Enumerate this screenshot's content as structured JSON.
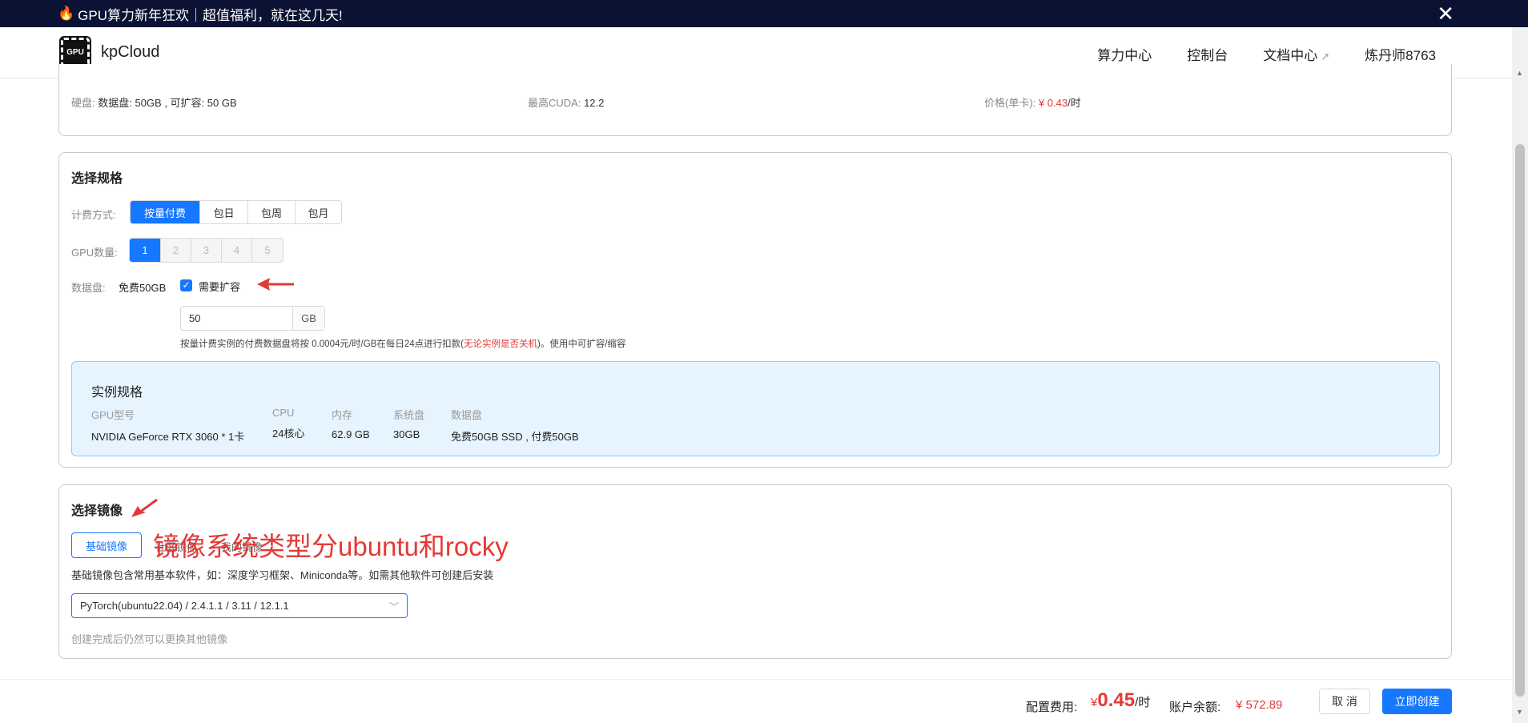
{
  "banner": {
    "fire_icon": "🔥",
    "text": "GPU算力新年狂欢｜超值福利，就在这几天!",
    "close": "✕"
  },
  "header": {
    "logo_text": "GPU",
    "brand": "kpCloud",
    "nav": [
      "算力中心",
      "控制台",
      "文档中心",
      "炼丹师8763"
    ],
    "doc_ext_icon": "↗"
  },
  "top_info": {
    "disk_label": "硬盘:",
    "disk_value": "数据盘: 50GB , 可扩容: 50 GB",
    "cuda_label": "最高CUDA:",
    "cuda_value": "12.2",
    "price_label": "价格(单卡):",
    "price_value": "¥ 0.43",
    "price_unit": "/时"
  },
  "spec": {
    "title": "选择规格",
    "billing_label": "计费方式:",
    "billing_options": [
      "按量付费",
      "包日",
      "包周",
      "包月"
    ],
    "billing_selected": "按量付费",
    "gpu_label": "GPU数量:",
    "gpu_options": [
      "1",
      "2",
      "3",
      "4",
      "5"
    ],
    "gpu_selected": "1",
    "disk_label": "数据盘:",
    "disk_free": "免费50GB",
    "expand_checkbox_label": "需要扩容",
    "expand_checked": true,
    "disk_input_value": "50",
    "disk_input_unit": "GB",
    "note_prefix": "按量计费实例的付费数据盘将按 0.0004元/时/GB在每日24点进行扣款(",
    "note_red": "无论实例是否关机",
    "note_suffix": ")。使用中可扩容/缩容"
  },
  "instance_spec": {
    "title": "实例规格",
    "columns": [
      {
        "key": "GPU型号",
        "value": "NVIDIA GeForce RTX 3060 * 1卡"
      },
      {
        "key": "CPU",
        "value": "24核心"
      },
      {
        "key": "内存",
        "value": "62.9 GB"
      },
      {
        "key": "系统盘",
        "value": "30GB"
      },
      {
        "key": "数据盘",
        "value": "免费50GB SSD , 付费50GB"
      }
    ]
  },
  "image": {
    "title": "选择镜像",
    "tabs": [
      "基础镜像",
      "社区镜像",
      "我的镜像"
    ],
    "tab_selected": "基础镜像",
    "annotation": "镜像系统类型分ubuntu和rocky",
    "description": "基础镜像包含常用基本软件，如：深度学习框架、Miniconda等。如需其他软件可创建后安装",
    "selected_image": "PyTorch(ubuntu22.04) / 2.4.1.1 / 3.11 / 12.1.1",
    "hint": "创建完成后仍然可以更换其他镜像"
  },
  "footer": {
    "cost_label": "配置费用:",
    "cost_currency": "¥",
    "cost_value": "0.45",
    "cost_unit": "/时",
    "balance_label": "账户余额:",
    "balance_value": "¥ 572.89",
    "cancel": "取 消",
    "create": "立即创建"
  },
  "colors": {
    "accent": "#1677ff",
    "danger": "#e53935",
    "banner_bg": "#0b1233"
  }
}
